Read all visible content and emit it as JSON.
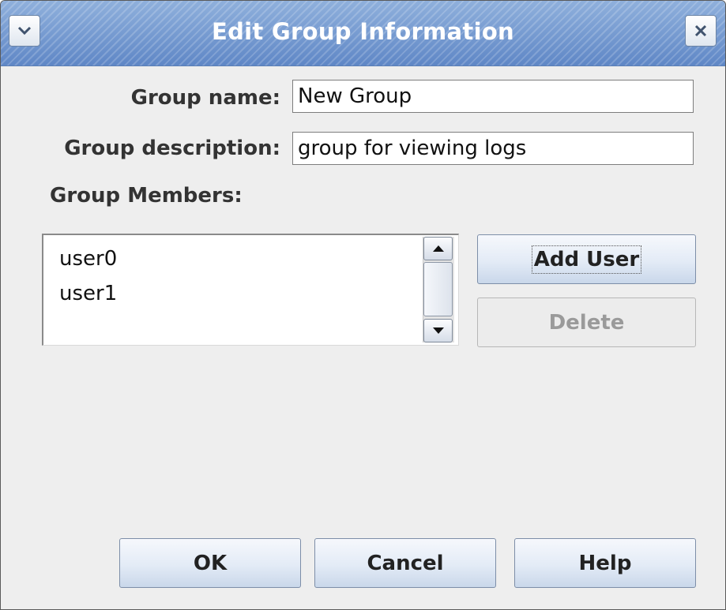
{
  "window": {
    "title": "Edit Group Information",
    "icons": {
      "menu": "chevron-down-icon",
      "close": "close-icon"
    }
  },
  "form": {
    "group_name_label": "Group name:",
    "group_name_value": "New Group",
    "group_description_label": "Group description:",
    "group_description_value": "group for viewing logs",
    "group_members_label": "Group Members:"
  },
  "members": {
    "items": [
      "user0",
      "user1"
    ]
  },
  "actions": {
    "add_user": "Add User",
    "delete": "Delete"
  },
  "footer": {
    "ok": "OK",
    "cancel": "Cancel",
    "help": "Help"
  },
  "colors": {
    "titlebar": "#6f95cf",
    "window_bg": "#eeeeee",
    "button_bg": "#e3ebf6"
  }
}
